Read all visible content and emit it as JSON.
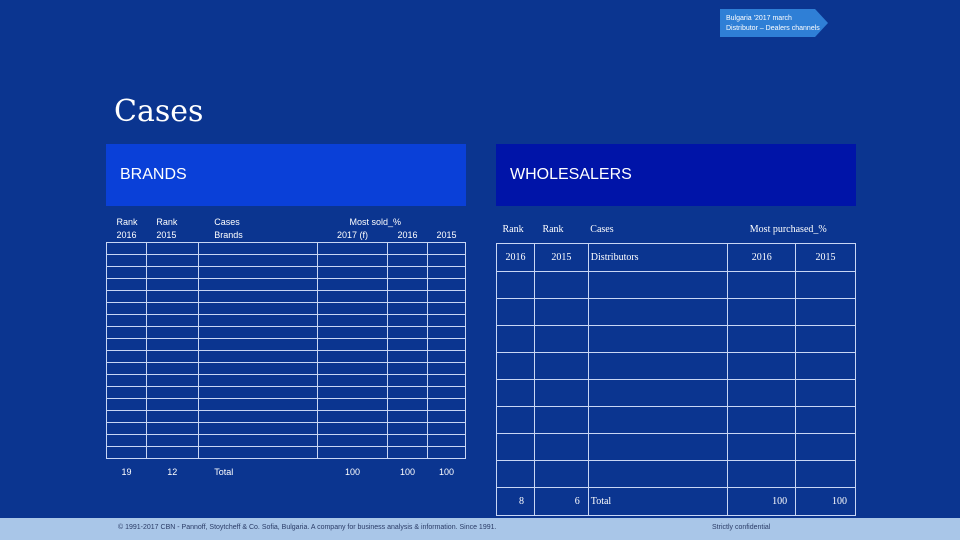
{
  "tag": {
    "line1": "Bulgaria '2017 march",
    "line2": "Distributor – Dealers channels"
  },
  "page_title": "Cases",
  "brands": {
    "title": "BRANDS",
    "header_row1": [
      "Rank",
      "Rank",
      "Cases",
      "Most sold_%",
      "",
      ""
    ],
    "header_row2": [
      "2016",
      "2015",
      "Brands",
      "2017 (f)",
      "2016",
      "2015"
    ],
    "total_row": [
      "19",
      "12",
      "Total",
      "100",
      "100",
      "100"
    ]
  },
  "wholesalers": {
    "title": "WHOLESALERS",
    "header_row1": [
      "Rank",
      "Rank",
      "Cases",
      "Most purchased_%",
      ""
    ],
    "header_row2": [
      "2016",
      "2015",
      "Distributors",
      "2016",
      "2015"
    ],
    "total_row": [
      "8",
      "6",
      "Total",
      "100",
      "100"
    ]
  },
  "footer": {
    "copyright": "© 1991-2017 CBN - Pannoff, Stoytcheff & Co. Sofia, Bulgaria. A company for business analysis & information. Since 1991.",
    "confidential": "Strictly confidential"
  }
}
